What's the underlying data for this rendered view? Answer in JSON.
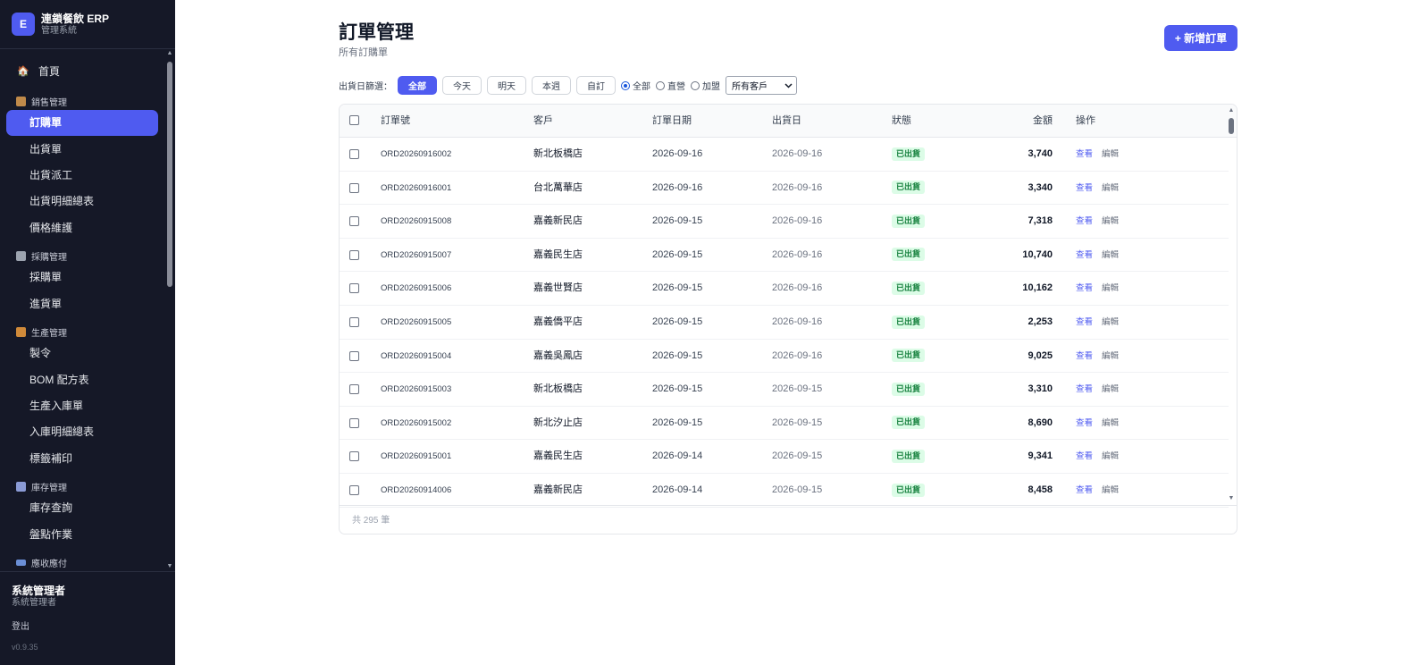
{
  "brand": {
    "logo": "E",
    "title": "連鎖餐飲 ERP",
    "subtitle": "管理系統"
  },
  "nav": {
    "home": {
      "label": "首頁",
      "icon": "🏠"
    },
    "groups": [
      {
        "label": "銷售管理",
        "icon": "box-icon",
        "color": "#c08a4a"
      },
      {
        "label": "採購管理",
        "icon": "cart-icon",
        "color": "#9ca3af"
      },
      {
        "label": "生產管理",
        "icon": "factory-icon",
        "color": "#d08a3a"
      },
      {
        "label": "庫存管理",
        "icon": "warehouse-icon",
        "color": "#8b9bd6"
      },
      {
        "label": "應收應付",
        "icon": "card-icon",
        "color": "#6b8fd6"
      }
    ],
    "items": [
      "訂購單",
      "出貨單",
      "出貨派工",
      "出貨明細總表",
      "價格維護",
      "採購單",
      "進貨單",
      "製令",
      "BOM 配方表",
      "生產入庫單",
      "入庫明細總表",
      "標籤補印",
      "庫存查詢",
      "盤點作業"
    ]
  },
  "user": {
    "name": "系統管理者",
    "role": "系統管理者",
    "logout": "登出",
    "version": "v0.9.35"
  },
  "page": {
    "title": "訂單管理",
    "subtitle": "所有訂購單",
    "new_button": "+ 新增訂單"
  },
  "filters": {
    "label": "出貨日篩選：",
    "chips": [
      "全部",
      "今天",
      "明天",
      "本週",
      "自訂"
    ],
    "radios": [
      "全部",
      "直營",
      "加盟"
    ],
    "select_value": "所有客戶"
  },
  "table": {
    "headers": [
      "訂單號",
      "客戶",
      "訂單日期",
      "出貨日",
      "狀態",
      "金額",
      "操作"
    ],
    "view_label": "查看",
    "edit_label": "編輯",
    "rows": [
      {
        "no": "ORD20260916002",
        "customer": "新北板橋店",
        "order_date": "2026-09-16",
        "ship_date": "2026-09-16",
        "status": "已出貨",
        "amount": "3,740"
      },
      {
        "no": "ORD20260916001",
        "customer": "台北萬華店",
        "order_date": "2026-09-16",
        "ship_date": "2026-09-16",
        "status": "已出貨",
        "amount": "3,340"
      },
      {
        "no": "ORD20260915008",
        "customer": "嘉義新民店",
        "order_date": "2026-09-15",
        "ship_date": "2026-09-16",
        "status": "已出貨",
        "amount": "7,318"
      },
      {
        "no": "ORD20260915007",
        "customer": "嘉義民生店",
        "order_date": "2026-09-15",
        "ship_date": "2026-09-16",
        "status": "已出貨",
        "amount": "10,740"
      },
      {
        "no": "ORD20260915006",
        "customer": "嘉義世賢店",
        "order_date": "2026-09-15",
        "ship_date": "2026-09-16",
        "status": "已出貨",
        "amount": "10,162"
      },
      {
        "no": "ORD20260915005",
        "customer": "嘉義僑平店",
        "order_date": "2026-09-15",
        "ship_date": "2026-09-16",
        "status": "已出貨",
        "amount": "2,253"
      },
      {
        "no": "ORD20260915004",
        "customer": "嘉義吳鳳店",
        "order_date": "2026-09-15",
        "ship_date": "2026-09-16",
        "status": "已出貨",
        "amount": "9,025"
      },
      {
        "no": "ORD20260915003",
        "customer": "新北板橋店",
        "order_date": "2026-09-15",
        "ship_date": "2026-09-15",
        "status": "已出貨",
        "amount": "3,310"
      },
      {
        "no": "ORD20260915002",
        "customer": "新北汐止店",
        "order_date": "2026-09-15",
        "ship_date": "2026-09-15",
        "status": "已出貨",
        "amount": "8,690"
      },
      {
        "no": "ORD20260915001",
        "customer": "嘉義民生店",
        "order_date": "2026-09-14",
        "ship_date": "2026-09-15",
        "status": "已出貨",
        "amount": "9,341"
      },
      {
        "no": "ORD20260914006",
        "customer": "嘉義新民店",
        "order_date": "2026-09-14",
        "ship_date": "2026-09-15",
        "status": "已出貨",
        "amount": "8,458"
      }
    ],
    "footer": "共 295 筆"
  },
  "colors": {
    "accent": "#4f5bf0",
    "sidebar_bg": "#151827",
    "badge_bg": "#dcfce7",
    "badge_text": "#15803d"
  }
}
